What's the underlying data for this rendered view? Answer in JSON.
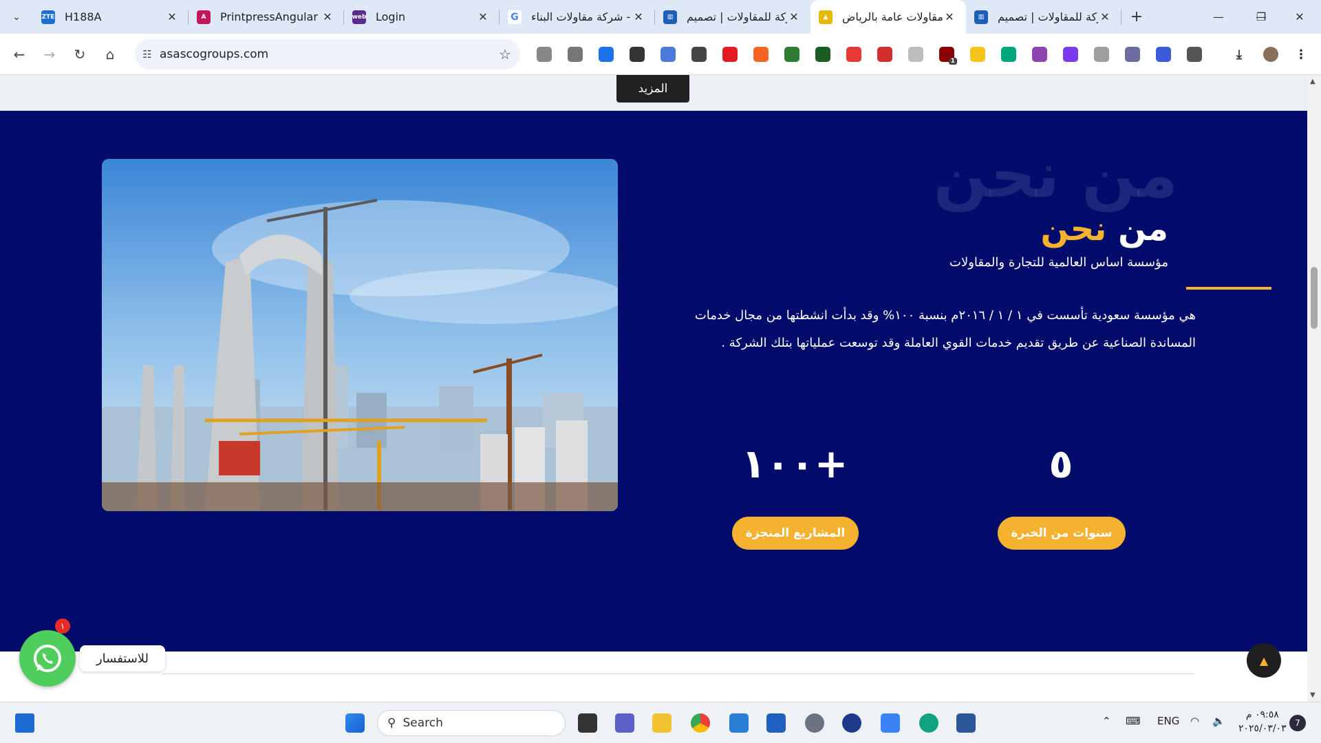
{
  "browser": {
    "tabs": [
      {
        "title": "H188A",
        "favicon": "zte-favicon",
        "fav_text": "ZTE",
        "fav_color": "#1a6fd3"
      },
      {
        "title": "PrintpressAngular",
        "favicon": "angular-favicon",
        "fav_text": "A",
        "fav_color": "#c2185b"
      },
      {
        "title": "Login",
        "favicon": "web-favicon",
        "fav_text": "web",
        "fav_color": "#5b2b8c"
      },
      {
        "title": "شركة مقاولات البناء -",
        "favicon": "google-favicon",
        "fav_text": "G",
        "fav_color": "#ffffff"
      },
      {
        "title": "شركة للمقاولات | تصميم",
        "favicon": "site-favicon",
        "fav_text": "▥",
        "fav_color": "#1c5fb8"
      },
      {
        "title": "شركة مقاولات عامة بالرياض",
        "favicon": "site-favicon",
        "fav_text": "▲",
        "fav_color": "#e6b800"
      },
      {
        "title": "شركة للمقاولات | تصميم",
        "favicon": "site-favicon",
        "fav_text": "▥",
        "fav_color": "#1c5fb8"
      }
    ],
    "active_tab_index": 5,
    "url": "asascogroups.com",
    "extension_badge": "1"
  },
  "page": {
    "more_button": "المزيد",
    "watermark": "من نحن",
    "title_part1": "من",
    "title_part2": "نحن",
    "subtitle": "مؤسسة اساس العالمية للتجارة والمقاولات",
    "paragraph": "هي مؤسسة سعودية تأسست في ١ / ١ / ٢٠١٦م بنسبة ١٠٠% وقد بدأت انشطتها من مجال خدمات المساندة الصناعية عن طريق تقديم خدمات القوي العاملة وقد توسعت عملياتها بتلك الشركة .",
    "stats": [
      {
        "number": "٥",
        "label": "سنوات من الخبرة"
      },
      {
        "number": "+١٠٠",
        "label": "المشاريع المنجزة"
      }
    ],
    "whatsapp_label": "للاستفسار",
    "whatsapp_badge": "١",
    "colors": {
      "navy": "#030c6b",
      "accent": "#f5b22e"
    }
  },
  "taskbar": {
    "search_placeholder": "Search",
    "language": "ENG",
    "time": "٠٩:٥٨ م",
    "date": "٢٠٢٥/٠٣/٠٣",
    "notification_count": "7"
  }
}
